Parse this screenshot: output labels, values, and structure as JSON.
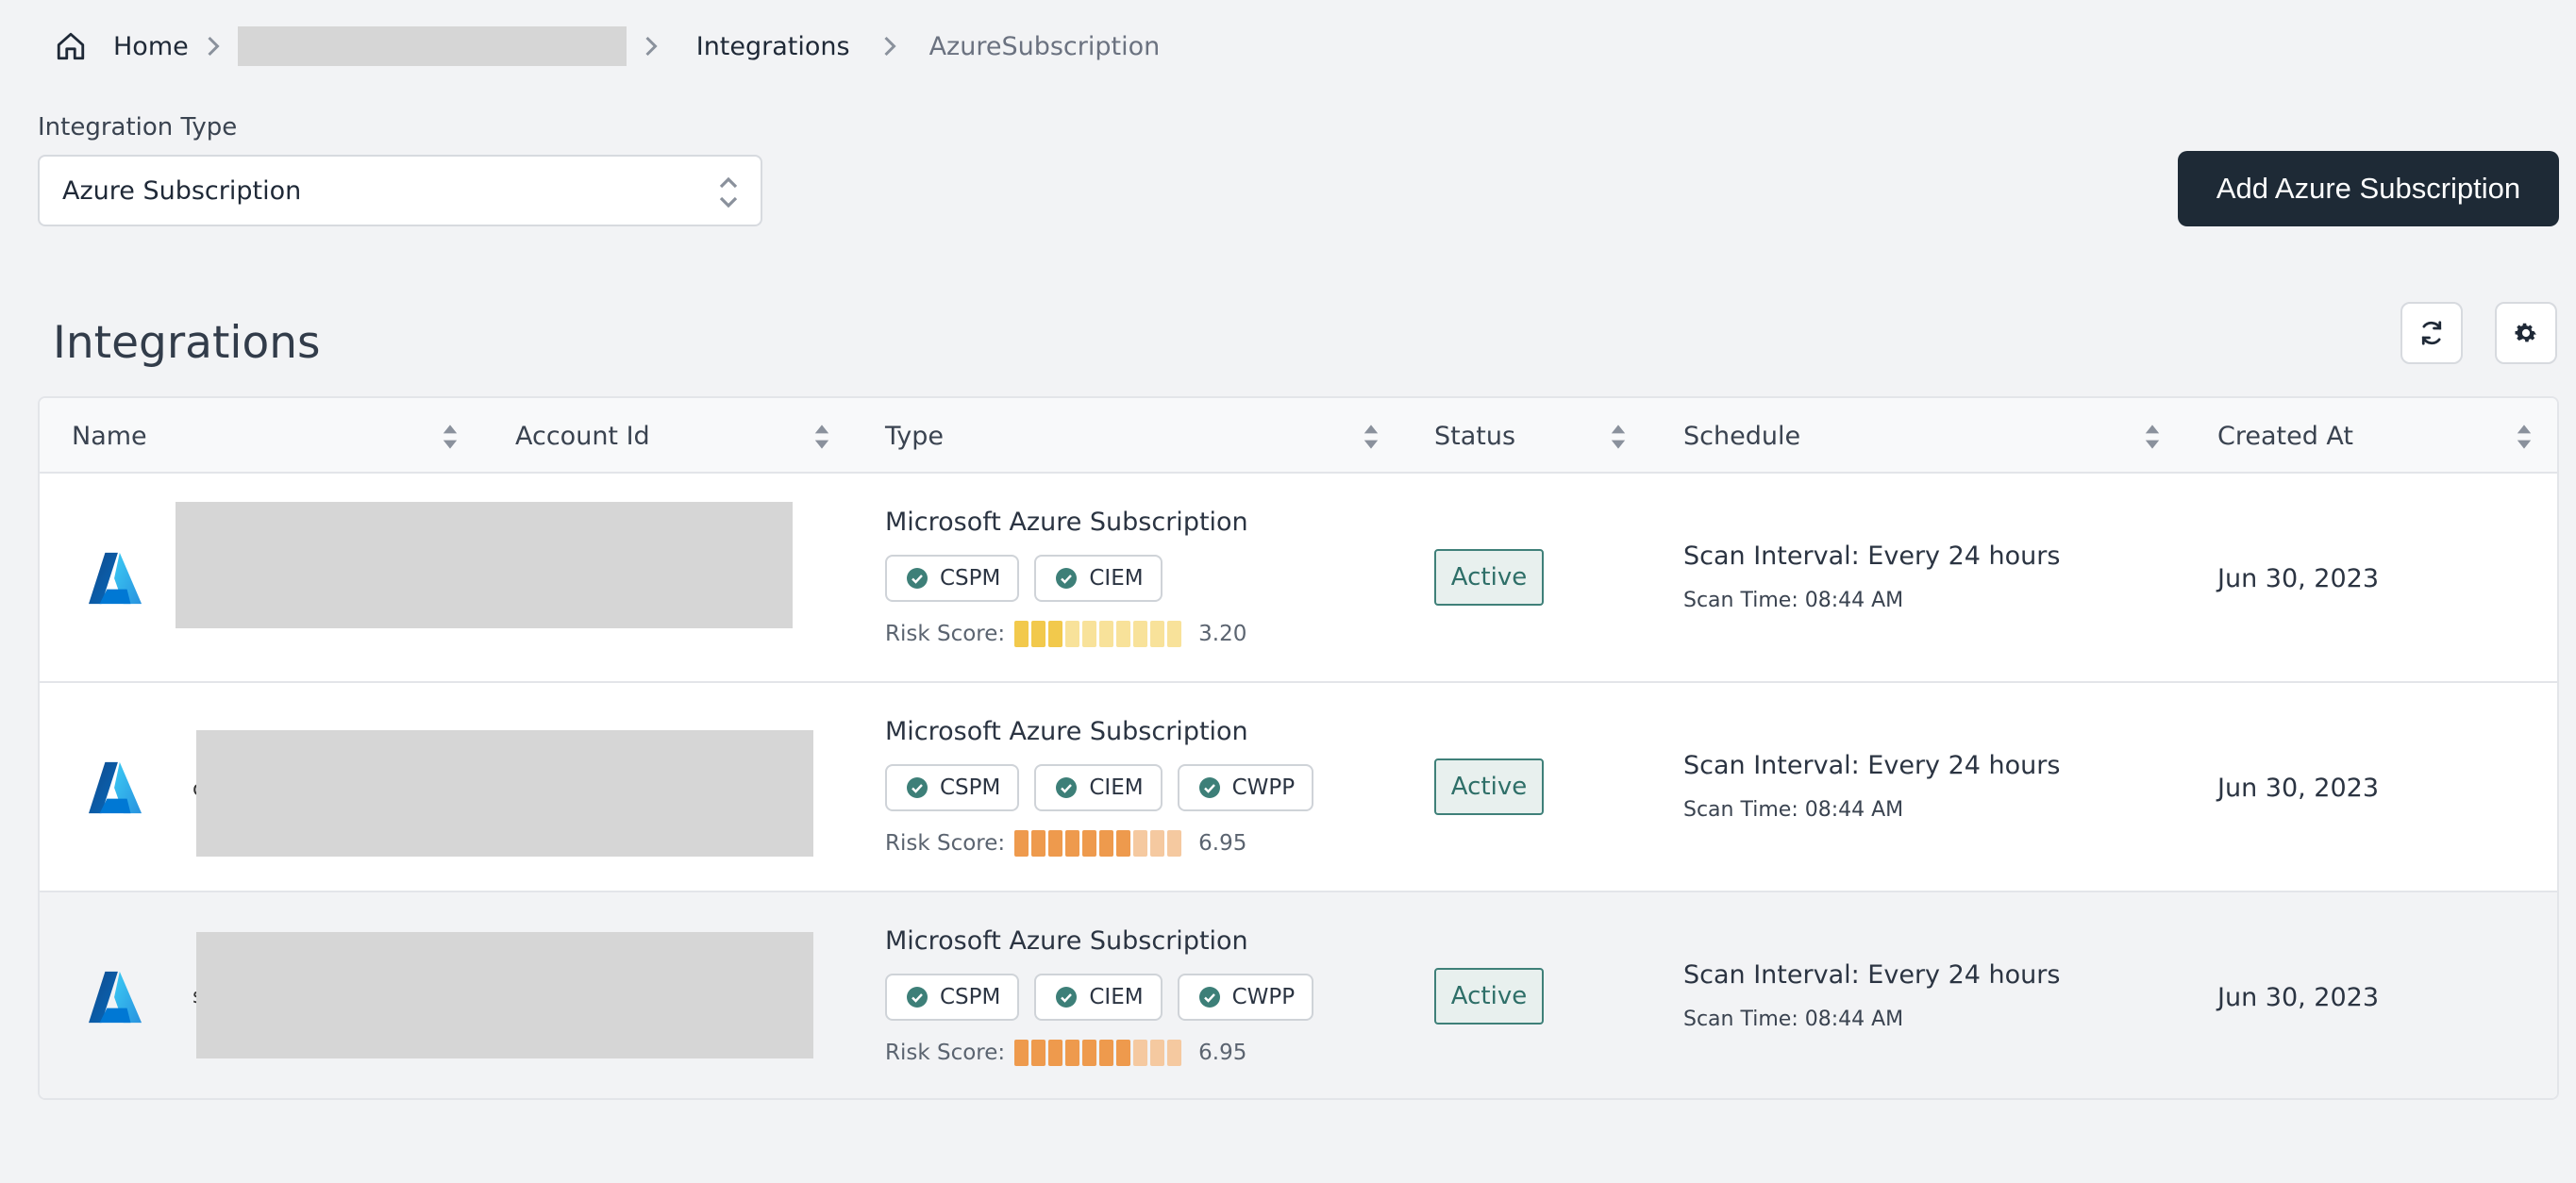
{
  "breadcrumb": {
    "home_label": "Home",
    "items": [
      "Integrations",
      "AzureSubscription"
    ]
  },
  "integration_type": {
    "label": "Integration Type",
    "selected": "Azure Subscription"
  },
  "add_button_label": "Add Azure Subscription",
  "section_title": "Integrations",
  "table": {
    "columns": [
      "Name",
      "Account Id",
      "Type",
      "Status",
      "Schedule",
      "Created At"
    ],
    "risk_label": "Risk Score:",
    "rows": [
      {
        "name_stub": "",
        "type": "Microsoft Azure Subscription",
        "tags": [
          "CSPM",
          "CIEM"
        ],
        "risk_score": "3.20",
        "risk_level": "yellow",
        "status": "Active",
        "schedule_interval": "Scan Interval: Every 24 hours",
        "schedule_time": "Scan Time: 08:44 AM",
        "created_at": "Jun 30, 2023"
      },
      {
        "name_stub": "c",
        "type": "Microsoft Azure Subscription",
        "tags": [
          "CSPM",
          "CIEM",
          "CWPP"
        ],
        "risk_score": "6.95",
        "risk_level": "orange",
        "status": "Active",
        "schedule_interval": "Scan Interval: Every 24 hours",
        "schedule_time": "Scan Time: 08:44 AM",
        "created_at": "Jun 30, 2023"
      },
      {
        "name_stub": "s",
        "type": "Microsoft Azure Subscription",
        "tags": [
          "CSPM",
          "CIEM",
          "CWPP"
        ],
        "risk_score": "6.95",
        "risk_level": "orange",
        "status": "Active",
        "schedule_interval": "Scan Interval: Every 24 hours",
        "schedule_time": "Scan Time: 08:44 AM",
        "created_at": "Jun 30, 2023"
      }
    ]
  },
  "colors": {
    "primary_button": "#1e2a36",
    "status_active": "#3f8079",
    "risk_yellow": "#f2c94c",
    "risk_orange": "#ee9a4d"
  }
}
